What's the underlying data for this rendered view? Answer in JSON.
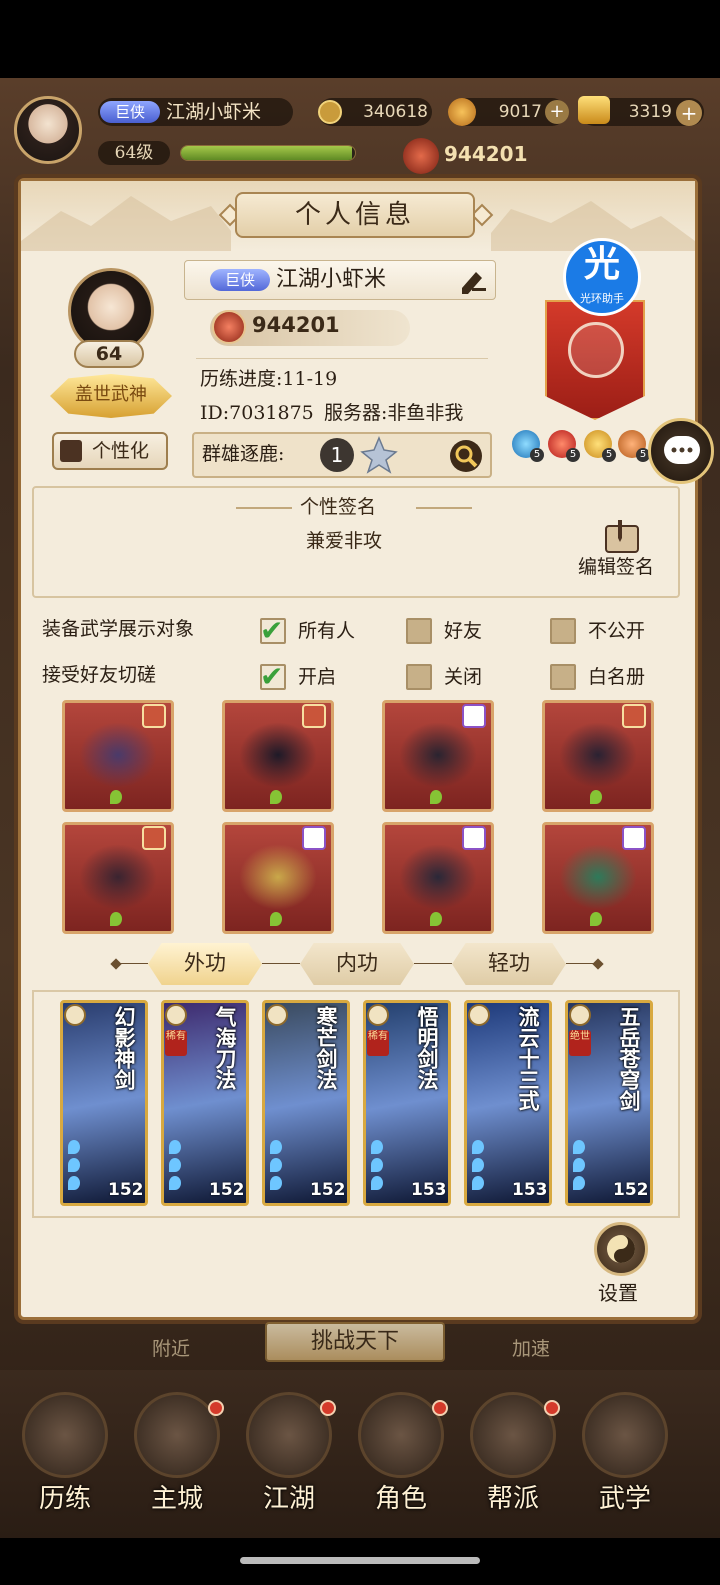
{
  "hud": {
    "rank_badge": "巨侠",
    "player_name": "江湖小虾米",
    "coins": "340618",
    "resource2": "9017",
    "gold_ingots": "3319",
    "level": "64级",
    "exp_fraction": 0.98,
    "combat_power": "944201"
  },
  "panel": {
    "title": "个人信息",
    "avatar_level": "64",
    "rank_emblem_text": "盖世武神",
    "personalize_label": "个性化",
    "rank_badge": "巨侠",
    "player_name": "江湖小虾米",
    "combat_power": "944201",
    "progress_text": "历练进度:11-19",
    "id_text": "ID:7031875",
    "server_text": "服务器:非鱼非我",
    "arena_label": "群雄逐鹿:",
    "arena_rank": "1",
    "guild_logo_char": "光",
    "guild_logo_sub": "光环助手",
    "gem_counts": [
      "5",
      "5",
      "5",
      "5"
    ]
  },
  "signature": {
    "title": "个性签名",
    "text": "兼爱非攻",
    "edit_label": "编辑签名"
  },
  "settings": {
    "row1_label": "装备武学展示对象",
    "row1_options": [
      "所有人",
      "好友",
      "不公开"
    ],
    "row1_selected": 0,
    "row2_label": "接受好友切磋",
    "row2_options": [
      "开启",
      "关闭",
      "白名册"
    ],
    "row2_selected": 0,
    "check_glyph": "✔"
  },
  "equipment": [
    {
      "name": "weapon",
      "rarity": "gold"
    },
    {
      "name": "robe",
      "rarity": "gold"
    },
    {
      "name": "belt",
      "rarity": "purple"
    },
    {
      "name": "boots",
      "rarity": "gold"
    },
    {
      "name": "necklace",
      "rarity": "gold"
    },
    {
      "name": "hairpin",
      "rarity": "purple"
    },
    {
      "name": "bracer",
      "rarity": "purple"
    },
    {
      "name": "ring",
      "rarity": "purple"
    }
  ],
  "tabs": [
    "外功",
    "内功",
    "轻功"
  ],
  "active_tab": 0,
  "martial_cards": [
    {
      "title": "幻影神剑",
      "level": "152",
      "tag": ""
    },
    {
      "title": "气海刀法",
      "level": "152",
      "tag": "稀有"
    },
    {
      "title": "寒芒剑法",
      "level": "152",
      "tag": ""
    },
    {
      "title": "悟明剑法",
      "level": "153",
      "tag": "稀有"
    },
    {
      "title": "流云十三式",
      "level": "153",
      "tag": ""
    },
    {
      "title": "五岳苍穹剑",
      "level": "152",
      "tag": "绝世"
    }
  ],
  "settings_button": "设置",
  "behind": {
    "challenge": "挑战天下",
    "nearby": "附近",
    "speed": "加速"
  },
  "bottom_nav": [
    "历练",
    "主城",
    "江湖",
    "角色",
    "帮派",
    "武学"
  ],
  "colors": {
    "panel_bg": "#f4ecdc",
    "equip_bg": "#9b3530",
    "card_border": "#d8a940",
    "check_green": "#3aa03a"
  }
}
